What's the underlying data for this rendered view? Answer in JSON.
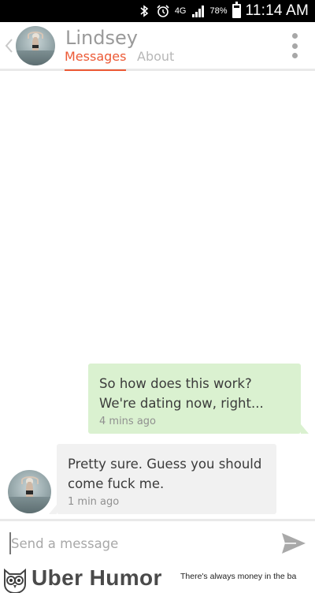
{
  "status_bar": {
    "network": "4G",
    "battery": "78%",
    "battery_level": 0.78,
    "time": "11:14 AM",
    "icons": [
      "bluetooth-icon",
      "alarm-icon",
      "network-4g-icon",
      "signal-icon",
      "battery-icon"
    ]
  },
  "header": {
    "name": "Lindsey",
    "tabs": [
      {
        "label": "Messages",
        "active": true
      },
      {
        "label": "About",
        "active": false
      }
    ],
    "accent_color": "#ec5a36"
  },
  "messages": [
    {
      "direction": "outgoing",
      "text": "So how does this work? We're dating now, right...",
      "time": "4 mins ago",
      "color": "#daf1d0"
    },
    {
      "direction": "incoming",
      "text": "Pretty sure. Guess you should come fuck me.",
      "time": "1 min ago",
      "color": "#f1f1f1"
    }
  ],
  "composer": {
    "placeholder": "Send a message",
    "value": ""
  },
  "footer": {
    "brand": "Uber Humor",
    "tagline": "There's always money in the ba"
  }
}
